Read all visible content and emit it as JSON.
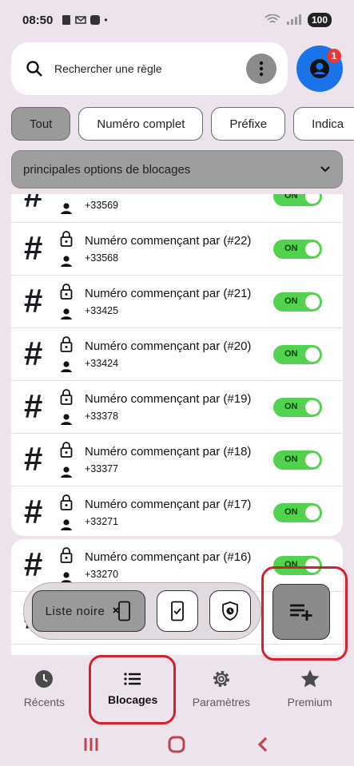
{
  "status": {
    "time": "08:50",
    "battery": "100"
  },
  "search": {
    "label": "Rechercher une règle",
    "badge": "1"
  },
  "chips": [
    "Tout",
    "Numéro complet",
    "Préfixe",
    "Indica"
  ],
  "dropdown": {
    "label": "principales options de blocages"
  },
  "rules": [
    {
      "title": "",
      "number": "+33569",
      "toggle": "ON"
    },
    {
      "title": "Numéro commençant par (#22)",
      "number": "+33568",
      "toggle": "ON"
    },
    {
      "title": "Numéro commençant par (#21)",
      "number": "+33425",
      "toggle": "ON"
    },
    {
      "title": "Numéro commençant par (#20)",
      "number": "+33424",
      "toggle": "ON"
    },
    {
      "title": "Numéro commençant par (#19)",
      "number": "+33378",
      "toggle": "ON"
    },
    {
      "title": "Numéro commençant par (#18)",
      "number": "+33377",
      "toggle": "ON"
    },
    {
      "title": "Numéro commençant par (#17)",
      "number": "+33271",
      "toggle": "ON"
    },
    {
      "title": "Numéro commençant par (#16)",
      "number": "+33270",
      "toggle": "ON"
    },
    {
      "title": "",
      "number": "",
      "toggle": "ON"
    }
  ],
  "actions": {
    "blacklist_label": "Liste noire"
  },
  "nav": [
    {
      "label": "Récents",
      "icon": "clock-icon"
    },
    {
      "label": "Blocages",
      "icon": "list-icon"
    },
    {
      "label": "Paramètres",
      "icon": "gear-icon"
    },
    {
      "label": "Premium",
      "icon": "star-icon"
    }
  ],
  "colors": {
    "toggle_on": "#52d24e",
    "highlight": "#d4202a",
    "avatar": "#1a73e8"
  }
}
